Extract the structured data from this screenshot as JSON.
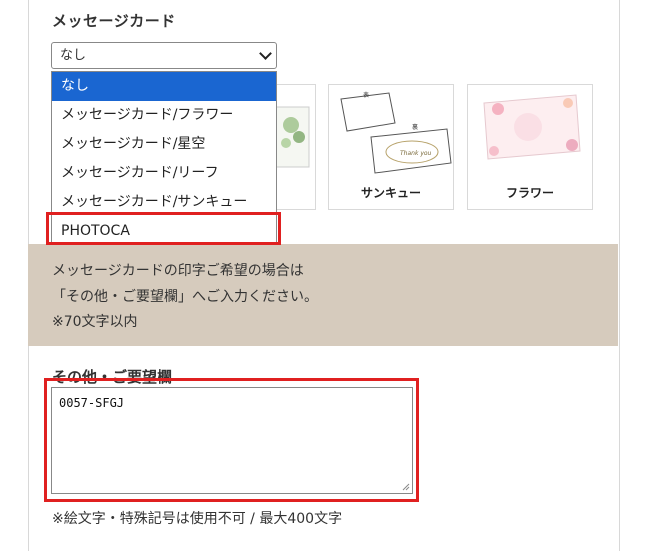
{
  "section": {
    "title": "メッセージカード"
  },
  "select": {
    "value": "なし",
    "options": [
      "なし",
      "メッセージカード/フラワー",
      "メッセージカード/星空",
      "メッセージカード/リーフ",
      "メッセージカード/サンキュー",
      "PHOTOCA"
    ]
  },
  "cards": [
    {
      "label": "サンキュー",
      "small_front": "表",
      "small_back": "裏",
      "script": "Thank you"
    },
    {
      "label": "フラワー"
    }
  ],
  "note": {
    "line1": "メッセージカードの印字ご希望の場合は",
    "line2": "「その他・ご要望欄」へご入力ください。",
    "line3": "※70文字以内"
  },
  "remarks": {
    "title": "その他・ご要望欄",
    "value": "0057-SFGJ",
    "help": "※絵文字・特殊記号は使用不可 / 最大400文字"
  },
  "colors": {
    "highlight": "#e02020",
    "selected": "#1a66d1",
    "band": "#d6cbbd"
  }
}
